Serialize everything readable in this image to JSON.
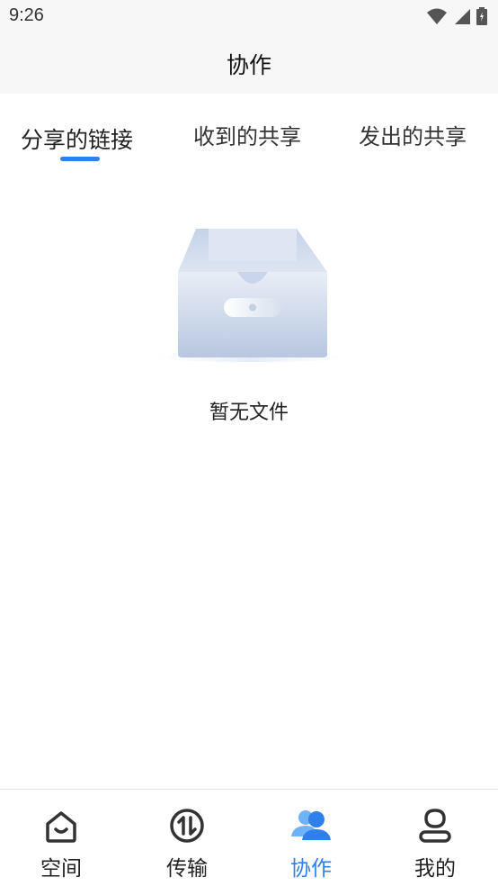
{
  "status_bar": {
    "time": "9:26",
    "icons": [
      "wifi-icon",
      "signal-icon",
      "battery-icon"
    ]
  },
  "app_bar": {
    "title": "协作"
  },
  "tabs": [
    {
      "label": "分享的链接",
      "active": true
    },
    {
      "label": "收到的共享",
      "active": false
    },
    {
      "label": "发出的共享",
      "active": false
    }
  ],
  "empty_state": {
    "icon": "empty-box-icon",
    "text": "暂无文件"
  },
  "bottom_nav": [
    {
      "label": "空间",
      "icon": "space-home-icon",
      "active": false
    },
    {
      "label": "传输",
      "icon": "transfer-icon",
      "active": false
    },
    {
      "label": "协作",
      "icon": "collaboration-users-icon",
      "active": true
    },
    {
      "label": "我的",
      "icon": "profile-icon",
      "active": false
    }
  ],
  "colors": {
    "accent": "#2f80ed",
    "bar_background": "#f7f7f7",
    "text": "#222222"
  }
}
